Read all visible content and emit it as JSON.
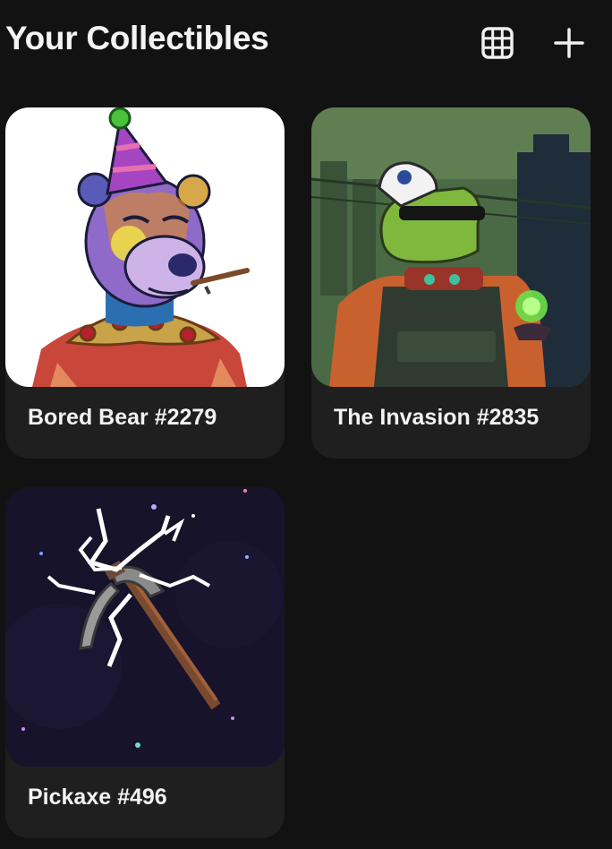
{
  "header": {
    "title": "Your Collectibles",
    "grid_icon": "grid-view-icon",
    "add_icon": "plus-icon"
  },
  "collectibles": [
    {
      "name": "Bored Bear #2279"
    },
    {
      "name": "The Invasion #2835"
    },
    {
      "name": "Pickaxe #496"
    }
  ],
  "colors": {
    "background": "#121212",
    "card": "#1f1f1f",
    "text": "#f2f2f2"
  }
}
